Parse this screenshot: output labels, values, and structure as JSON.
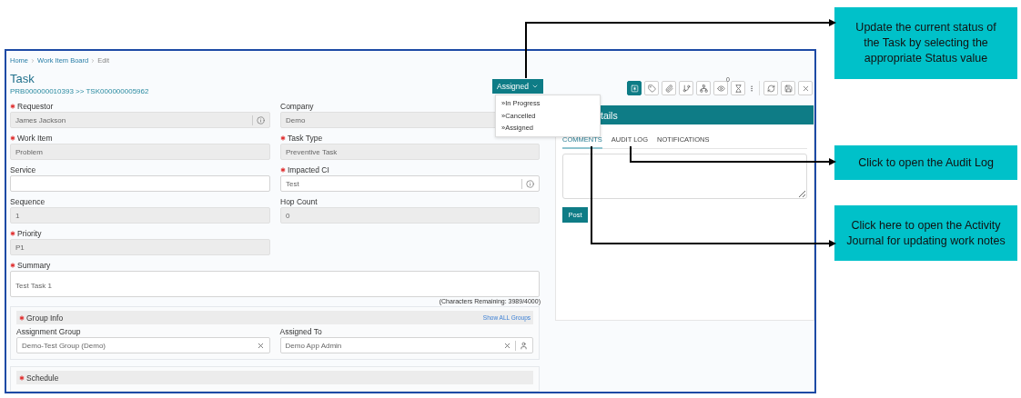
{
  "breadcrumb": [
    {
      "label": "Home",
      "selected": false
    },
    {
      "label": "Work Item Board",
      "selected": false
    },
    {
      "label": "Edit",
      "selected": true
    }
  ],
  "title": "Task",
  "subtitle": "PRB000000010393 >> TSK000000005962",
  "status": {
    "label": "Assigned",
    "expanded": true,
    "options": [
      {
        "label": "»In Progress"
      },
      {
        "label": "»Cancelled"
      },
      {
        "label": "»Assigned"
      }
    ]
  },
  "rows": [
    {
      "fields": [
        {
          "label": "Requestor",
          "required": true,
          "value": "James Jackson",
          "readonly": true,
          "kind": "lookup"
        },
        {
          "label": "Company",
          "required": false,
          "value": "Demo",
          "readonly": true,
          "kind": "text"
        }
      ]
    },
    {
      "fields": [
        {
          "label": "Work Item",
          "required": true,
          "value": "Problem",
          "readonly": true,
          "kind": "text"
        },
        {
          "label": "Task Type",
          "required": true,
          "value": "Preventive Task",
          "readonly": true,
          "kind": "text"
        }
      ]
    },
    {
      "fields": [
        {
          "label": "Service",
          "required": false,
          "readonly": false,
          "kind": "text"
        },
        {
          "label": "Impacted CI",
          "required": true,
          "value": "Test",
          "readonly": false,
          "kind": "lookup"
        }
      ]
    },
    {
      "fields": [
        {
          "label": "Sequence",
          "required": false,
          "value": "1",
          "readonly": true,
          "kind": "text"
        },
        {
          "label": "Hop Count",
          "required": false,
          "value": "0",
          "readonly": true,
          "kind": "text"
        }
      ]
    },
    {
      "fields": [
        {
          "label": "Priority",
          "required": true,
          "value": "P1",
          "readonly": true,
          "kind": "text"
        }
      ]
    }
  ],
  "summary": {
    "label": "Summary",
    "required": true,
    "value": "Test Task 1",
    "counter": "(Characters Remaining: 3989/4000)"
  },
  "group_info": {
    "title": "Group Info",
    "required": true,
    "link": "Show ALL Groups",
    "fields": [
      {
        "label": "Assignment Group",
        "value": "Demo-Test Group (Demo)",
        "kind": "clearable"
      },
      {
        "label": "Assigned To",
        "value": "Demo App Admin",
        "kind": "person"
      }
    ]
  },
  "schedule": {
    "title": "Schedule",
    "required": true
  },
  "toolbar": [
    {
      "kind": "asterisk",
      "selected": true
    },
    {
      "kind": "tag",
      "selected": false
    },
    {
      "kind": "clip",
      "selected": false
    },
    {
      "kind": "branch",
      "selected": false
    },
    {
      "kind": "network",
      "selected": false
    },
    {
      "kind": "eye",
      "selected": false,
      "badge": "0"
    },
    {
      "kind": "hourglass",
      "selected": false
    },
    {
      "kind": "more",
      "selected": false
    },
    {
      "kind": "divider"
    },
    {
      "kind": "refresh",
      "selected": false
    },
    {
      "kind": "save",
      "selected": false
    },
    {
      "kind": "close",
      "selected": false
    }
  ],
  "details": {
    "header": "tails",
    "tabs": [
      {
        "label": "COMMENTS",
        "selected": true
      },
      {
        "label": "AUDIT LOG",
        "selected": false
      },
      {
        "label": "NOTIFICATIONS",
        "selected": false
      }
    ],
    "post": "Post"
  },
  "callouts": [
    {
      "text": "Update the current status of the Task by selecting the appropriate Status value"
    },
    {
      "text": "Click  to open the Audit Log"
    },
    {
      "text": "Click here to open the Activity Journal for updating work notes"
    }
  ]
}
